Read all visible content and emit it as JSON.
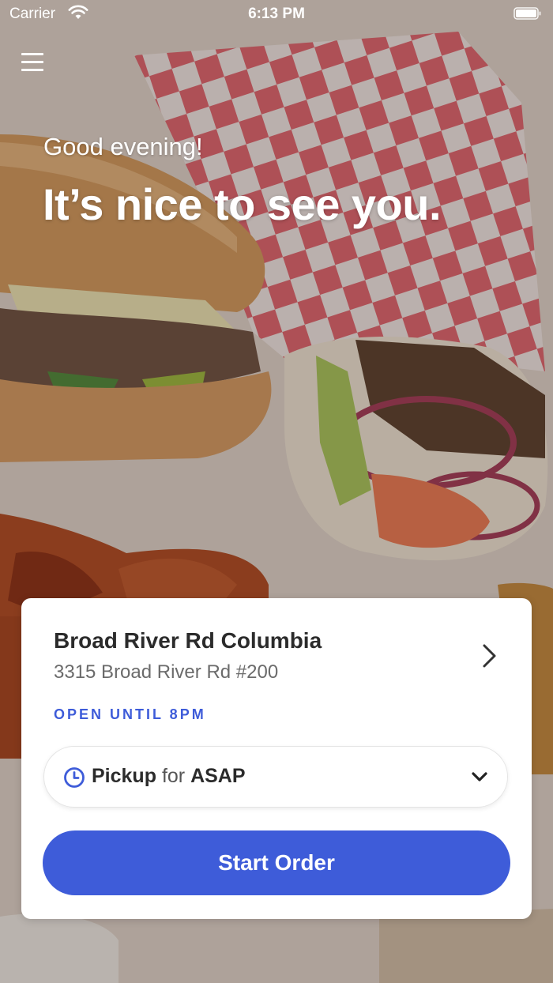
{
  "status_bar": {
    "carrier": "Carrier",
    "time": "6:13 PM",
    "icons": [
      "wifi-icon",
      "battery-icon"
    ]
  },
  "menu": {
    "icon": "hamburger-menu-icon"
  },
  "greeting": {
    "salutation": "Good evening!",
    "headline": "It’s nice to see you."
  },
  "location": {
    "name": "Broad River Rd Columbia",
    "address": "3315 Broad River Rd #200",
    "hours": "OPEN UNTIL 8PM"
  },
  "order_time": {
    "mode": "Pickup",
    "connector": "for",
    "when": "ASAP"
  },
  "cta": {
    "label": "Start Order"
  },
  "colors": {
    "accent": "#3e5cd9",
    "card_background": "#ffffff",
    "text_primary": "#2b2b2b",
    "text_secondary": "#6b6b6b"
  }
}
